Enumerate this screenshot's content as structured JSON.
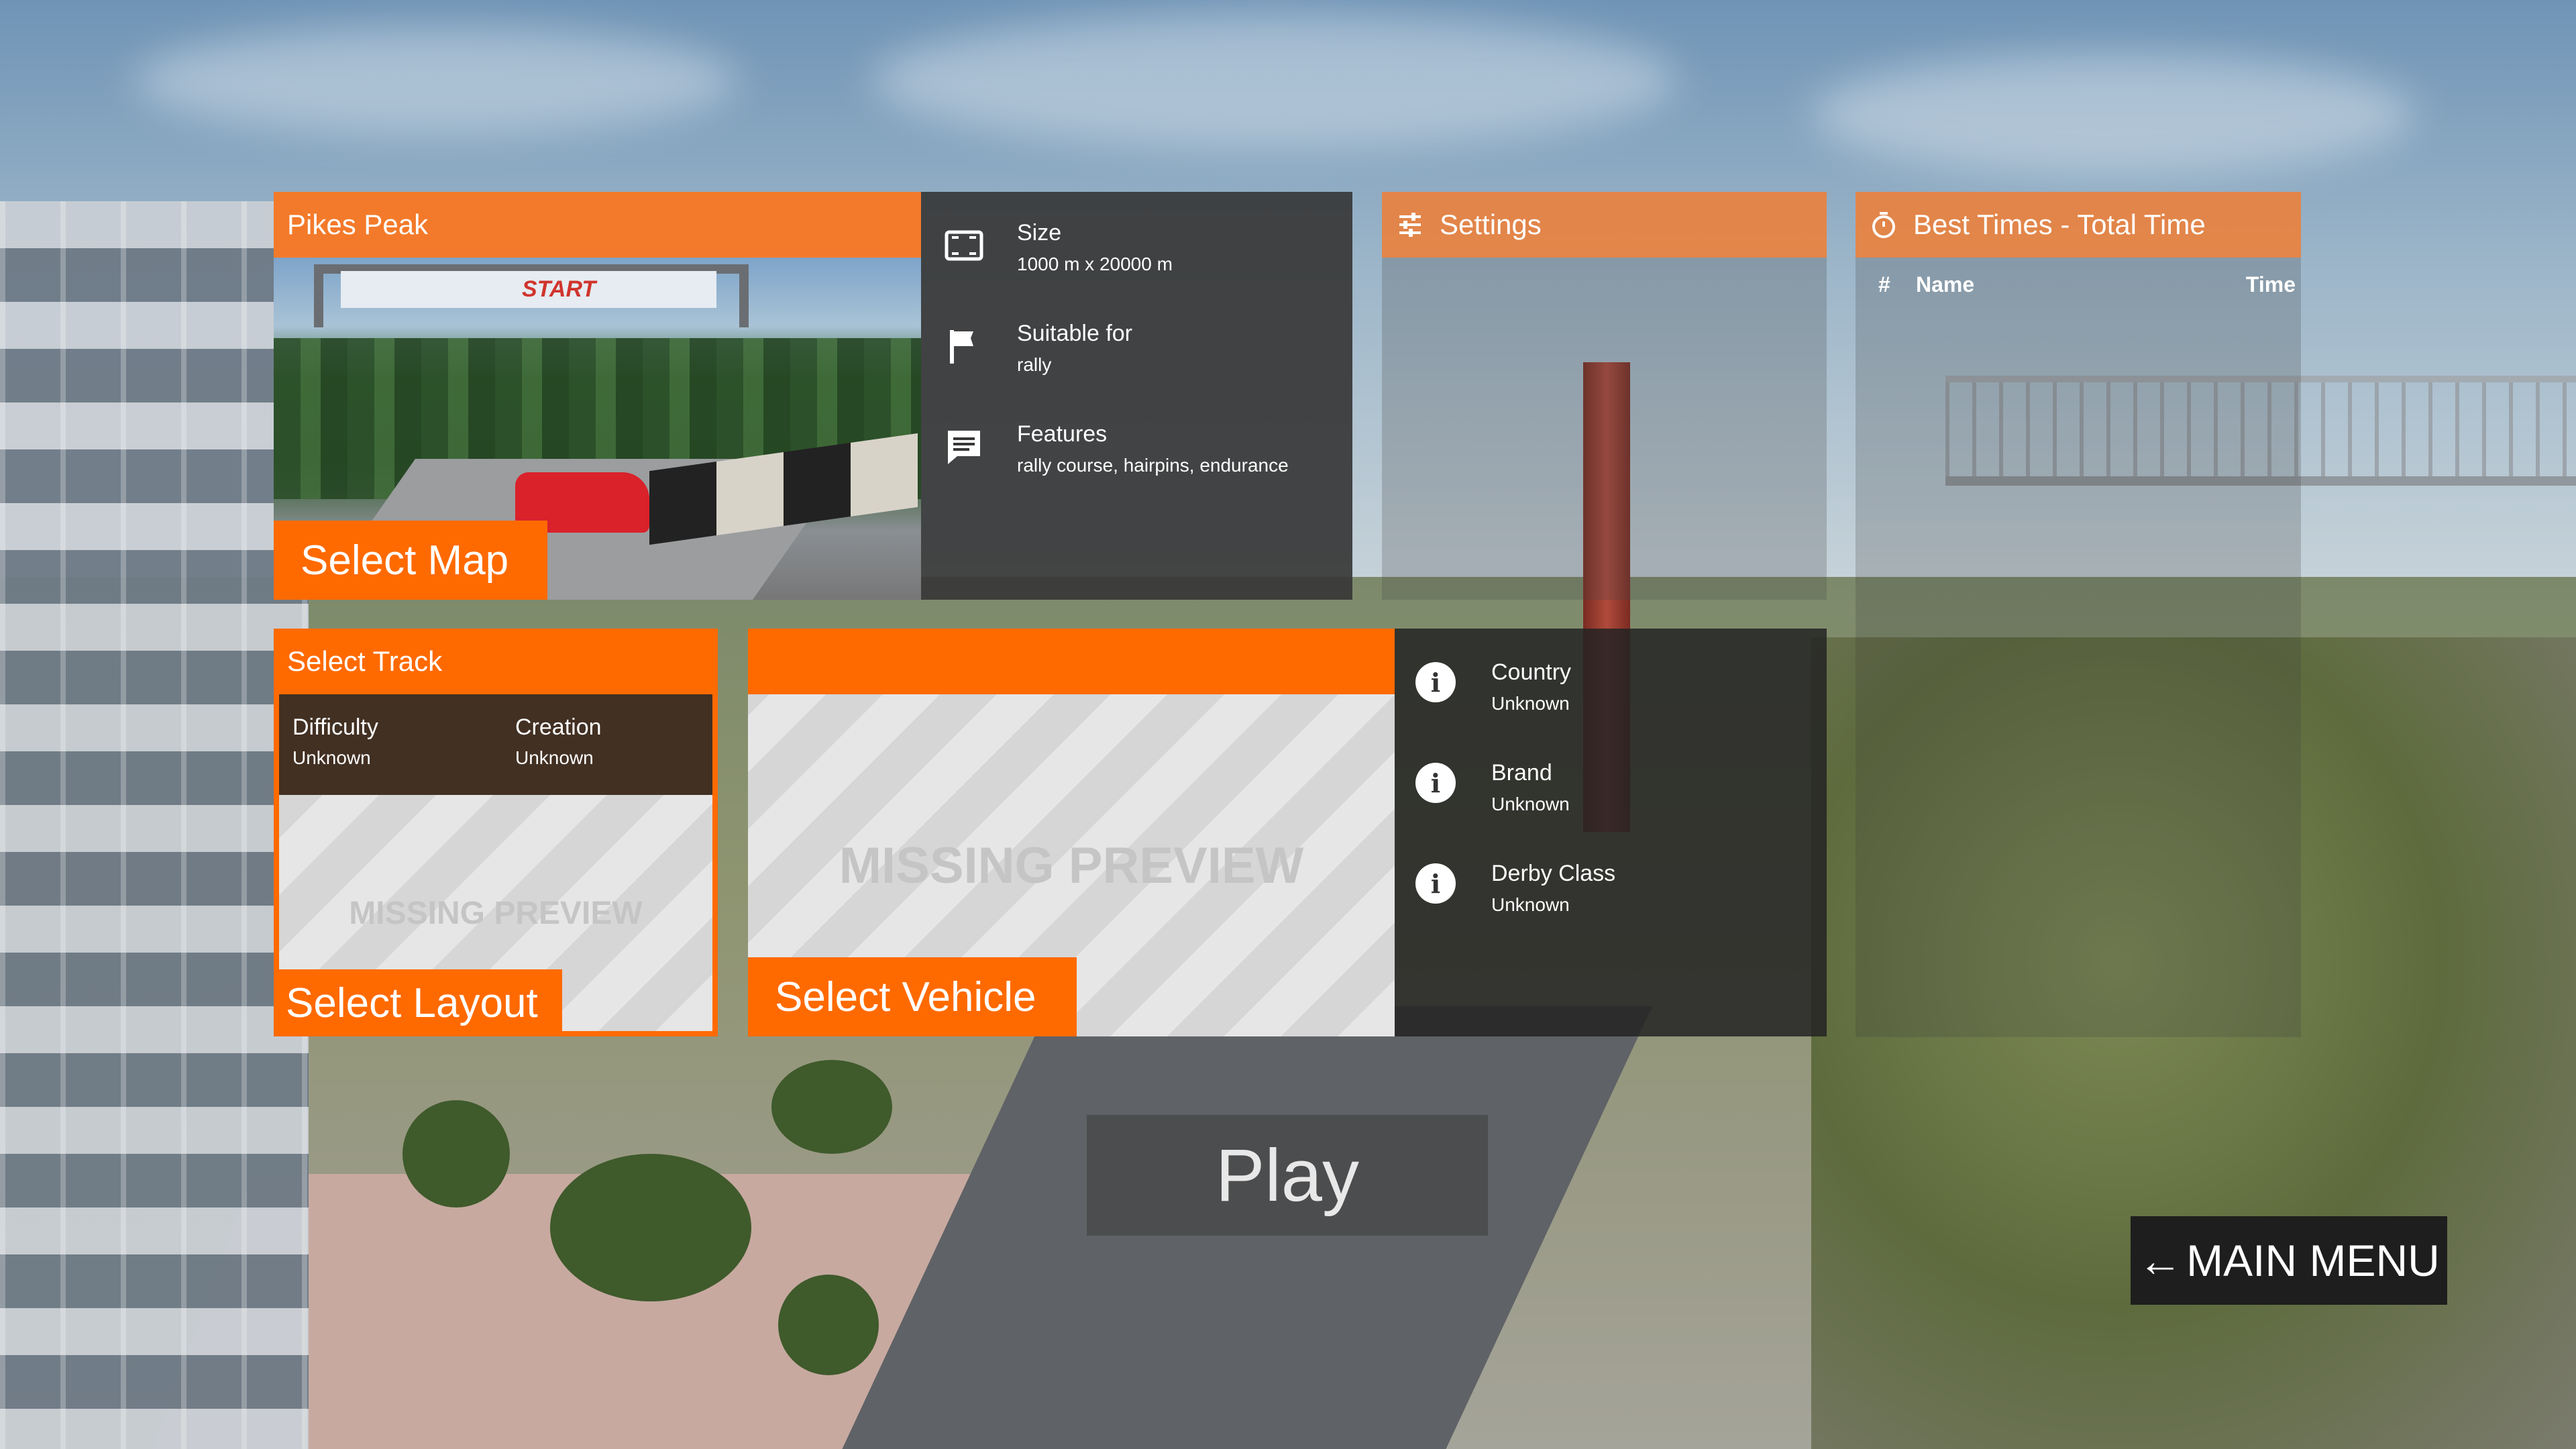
{
  "map": {
    "title": "Pikes Peak",
    "select_label": "Select Map",
    "preview_banner_text": "START"
  },
  "map_info": {
    "size_label": "Size",
    "size_value": "1000 m x 20000 m",
    "suitable_label": "Suitable for",
    "suitable_value": "rally",
    "features_label": "Features",
    "features_value": "rally course, hairpins, endurance",
    "icons": [
      "size-icon",
      "flag-icon",
      "comment-icon"
    ]
  },
  "settings": {
    "title": "Settings",
    "icon": "tune-icon"
  },
  "best_times": {
    "title": "Best Times - Total Time",
    "icon": "stopwatch-icon",
    "columns": [
      "#",
      "Name",
      "Time"
    ]
  },
  "track": {
    "title": "Select Track",
    "difficulty_label": "Difficulty",
    "difficulty_value": "Unknown",
    "creation_label": "Creation",
    "creation_value": "Unknown",
    "preview_text": "MISSING PREVIEW",
    "select_label": "Select Layout"
  },
  "vehicle": {
    "preview_text": "MISSING PREVIEW",
    "select_label": "Select Vehicle"
  },
  "vehicle_info": {
    "rows": [
      {
        "label": "Country",
        "value": "Unknown"
      },
      {
        "label": "Brand",
        "value": "Unknown"
      },
      {
        "label": "Derby Class",
        "value": "Unknown"
      }
    ],
    "icon": "info-icon"
  },
  "play_label": "Play",
  "main_menu_label": "MAIN MENU",
  "colors": {
    "accent": "#ff6a00",
    "header": "#f37a2a",
    "panel_dark": "#373737"
  }
}
